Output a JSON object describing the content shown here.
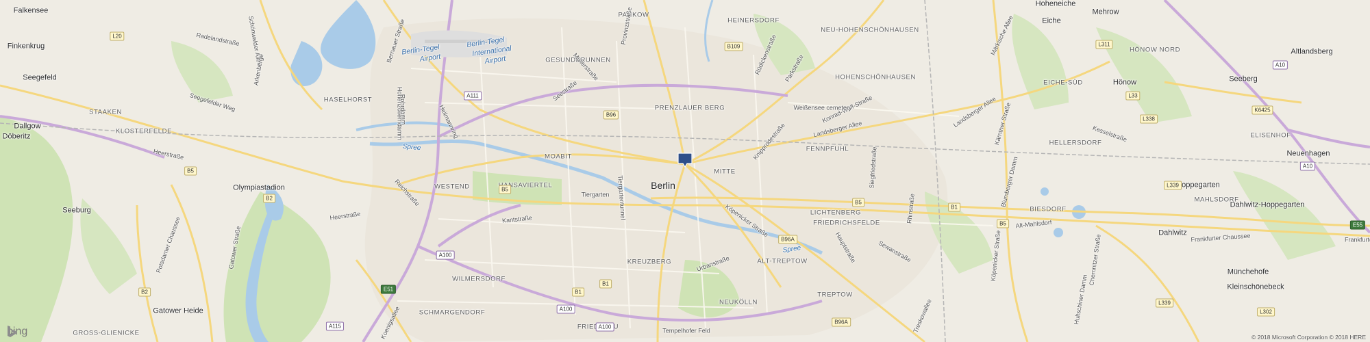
{
  "city_label": "Berlin",
  "towns": [
    "Falkensee",
    "Finkenkrug",
    "Seegefeld",
    "Döberitz",
    "Dallgow",
    "Seeburg",
    "Hoheneiche",
    "Eiche",
    "Mehrow",
    "Altlandsberg",
    "Hönow",
    "Seeberg",
    "Neuenhagen",
    "Hoppegarten",
    "Dahlwitz-Hoppegarten",
    "Dahlwitz",
    "Münchehofe",
    "Kleinschönebeck",
    "Gatower Heide",
    "Olympiastadion"
  ],
  "districts": [
    "PANKOW",
    "HEINERSDORF",
    "NEU-HOHENSCHÖNHAUSEN",
    "GESUNDBRUNNEN",
    "HOHENSCHÖNHAUSEN",
    "HASELHORST",
    "STAAKEN",
    "PRENZLAUER BERG",
    "EICHE-SÜD",
    "HÖNOW NORD",
    "KLOSTERFELDE",
    "FENNPFUHL",
    "HELLERSDORF",
    "ELISENHOF",
    "MOABIT",
    "MITTE",
    "WESTEND",
    "HANSAVIERTEL",
    "LICHTENBERG",
    "MAHLSDORF",
    "BIESDORF",
    "FRIEDRICHSFELDE",
    "KREUZBERG",
    "ALT-TREPTOW",
    "WILMERSDORF",
    "TREPTOW",
    "SCHMARGENDORF",
    "NEUKÖLLN",
    "FRIEDENAU",
    "GROSS-GLIENICKE"
  ],
  "streets": [
    "Radelandstraße",
    "Schönwalder Allee",
    "Bernauer Straße",
    "Provinzstraße",
    "Seegefelder Weg",
    "Müllerstraße",
    "Seestraße",
    "Heerstraße",
    "Reichstraße",
    "Heerstraße",
    "Kantstraße",
    "Tiergarten",
    "Tiergartentunnel",
    "Potsdamer Chaussee",
    "Gatower Straße",
    "Hohenzollerndamm",
    "Urbanstraße",
    "Köpenicker Straße",
    "Knipprodestraße",
    "Landsberger Allee",
    "Landsberger Allee",
    "Märkische Allee",
    "Blumberger Damm",
    "Alt-Mahlsdorf",
    "Frankfurter Chaussee",
    "Hauptstraße",
    "Siegfriedstraße",
    "Rhinstraße",
    "Köpenicker Straße",
    "Chemnitzer Straße",
    "Hultschiner Damm",
    "Treskowallee",
    "Sewanstraße",
    "Koenigsallee",
    "Tempelhofer Feld",
    "Rüdickenstraße",
    "Parkstraße",
    "Konrad-Wolf-Straße",
    "Kärntner Straße",
    "Weißensee cemetery",
    "Heilmannring",
    "Arkenberge",
    "Rohrdamm",
    "Kesselstraße",
    "Frankfurter"
  ],
  "water": [
    "Spree",
    "Spree"
  ],
  "airport": [
    "Berlin-Tegel",
    "Airport",
    "Berlin-Tegel",
    "International",
    "Airport"
  ],
  "shields": [
    "L20",
    "A111",
    "B96",
    "B109",
    "A10",
    "L311",
    "L33",
    "K6425",
    "L338",
    "B5",
    "B5",
    "B2",
    "B1",
    "B5",
    "B5",
    "A100",
    "B96A",
    "A100",
    "B1",
    "B1",
    "A115",
    "E51",
    "L339",
    "A10",
    "B2",
    "L339",
    "L302",
    "B96A",
    "A100",
    "E55"
  ],
  "copyright": "© 2018 Microsoft Corporation © 2018 HERE",
  "logo_text": "bing",
  "colors": {
    "land": "#efece4",
    "park": "#cfe3b5",
    "water": "#a9cbe8",
    "major_road": "#f5d77e",
    "motorway": "#c9a9d9",
    "marker": "#2e4f8a"
  }
}
